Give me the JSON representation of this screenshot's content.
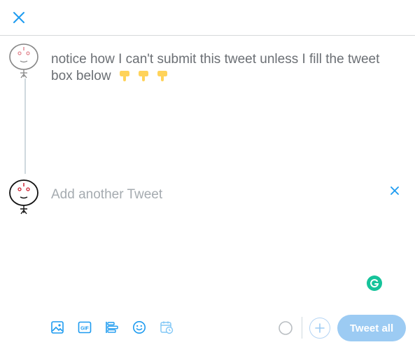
{
  "composer": {
    "tweets": [
      {
        "text": "notice how I can't submit this tweet unless I fill the tweet box below",
        "emoji": [
          "👇",
          "👇",
          "👇"
        ]
      }
    ],
    "next_placeholder": "Add another Tweet"
  },
  "toolbar": {
    "icons": [
      "image-icon",
      "gif-icon",
      "poll-icon",
      "emoji-icon",
      "schedule-icon"
    ],
    "tweet_all_label": "Tweet all"
  },
  "colors": {
    "accent": "#1d9bf0",
    "accent_disabled": "#9ccbf3",
    "text": "#6b6f74",
    "placeholder": "#a5abb0",
    "grammarly": "#15c39a",
    "hand_emoji": "#ffd35a"
  }
}
